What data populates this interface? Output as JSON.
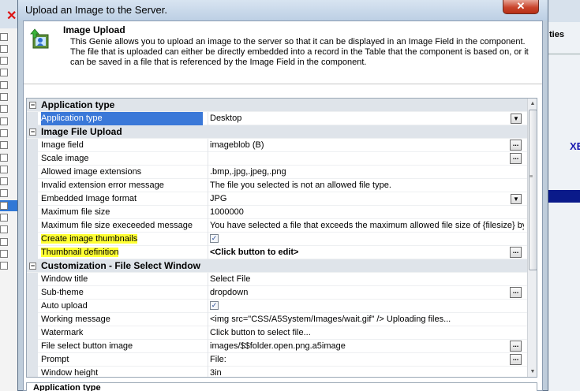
{
  "dialog": {
    "title": "Upload an Image to the Server.",
    "close_label": "✕"
  },
  "header": {
    "title": "Image Upload",
    "description": "This Genie allows you to upload an image to the server so that it can be displayed in an Image Field in the component. The file that is uploaded can either be directly embedded into a record in the Table that the component is based on, or it can be saved in a file that is referenced by the Image Field in the component."
  },
  "background": {
    "right_text": "ties",
    "right_text2": "XE"
  },
  "grid": {
    "sections": [
      {
        "category": "Application type",
        "rows": [
          {
            "name": "Application type",
            "value": "Desktop",
            "editor": "dropdown",
            "selected": true
          }
        ]
      },
      {
        "category": "Image File Upload",
        "rows": [
          {
            "name": "Image field",
            "value": "imageblob (B)",
            "editor": "ellipsis"
          },
          {
            "name": "Scale image",
            "value": "",
            "editor": "ellipsis"
          },
          {
            "name": "Allowed image extensions",
            "value": ".bmp,.jpg,.jpeg,.png",
            "editor": ""
          },
          {
            "name": "Invalid extension error message",
            "value": "The file you selected is not an allowed file type.",
            "editor": ""
          },
          {
            "name": "Embedded Image format",
            "value": "JPG",
            "editor": "dropdown"
          },
          {
            "name": "Maximum file size",
            "value": "1000000",
            "editor": ""
          },
          {
            "name": "Maximum file size execeeded message",
            "value": "You have selected a file that exceeds the maximum allowed file size of {filesize} bytes",
            "editor": ""
          },
          {
            "name": "Create image thumbnails",
            "value": "",
            "editor": "checkbox",
            "checked": true,
            "highlight": true
          },
          {
            "name": "Thumbnail definition",
            "value": "<Click button to edit>",
            "editor": "ellipsis",
            "highlight": true,
            "bold_value": true
          }
        ]
      },
      {
        "category": "Customization - File Select Window",
        "rows": [
          {
            "name": "Window title",
            "value": "Select File",
            "editor": ""
          },
          {
            "name": "Sub-theme",
            "value": "dropdown",
            "editor": "ellipsis"
          },
          {
            "name": "Auto upload",
            "value": "",
            "editor": "checkbox",
            "checked": true
          },
          {
            "name": "Working message",
            "value": "<img src=\"CSS/A5System/Images/wait.gif\" /> Uploading files...",
            "editor": ""
          },
          {
            "name": "Watermark",
            "value": "Click button to select file...",
            "editor": ""
          },
          {
            "name": "File select button image",
            "value": "images/$$folder.open.png.a5image",
            "editor": "ellipsis"
          },
          {
            "name": "Prompt",
            "value": "File:",
            "editor": "ellipsis"
          },
          {
            "name": "Window height",
            "value": "3in",
            "editor": ""
          }
        ]
      }
    ]
  },
  "bottom_label": "Application type",
  "colors": {
    "selection": "#3a78d8",
    "highlight": "#ffff33",
    "category_bg": "#dfe4ea"
  }
}
